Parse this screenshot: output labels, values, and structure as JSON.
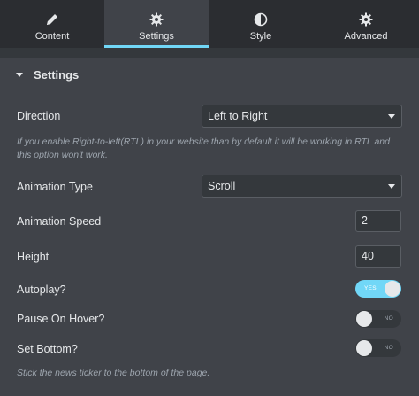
{
  "tabs": [
    {
      "label": "Content",
      "icon": "pencil-icon",
      "active": false
    },
    {
      "label": "Settings",
      "icon": "gear-icon",
      "active": true
    },
    {
      "label": "Style",
      "icon": "half-circle-icon",
      "active": false
    },
    {
      "label": "Advanced",
      "icon": "gear-icon",
      "active": false
    }
  ],
  "section": {
    "title": "Settings",
    "icon": "caret-down-icon"
  },
  "fields": {
    "direction": {
      "label": "Direction",
      "value": "Left to Right",
      "hint": "If you enable Right-to-left(RTL) in your website than by default it will be working in RTL and this option won't work."
    },
    "animation_type": {
      "label": "Animation Type",
      "value": "Scroll"
    },
    "animation_speed": {
      "label": "Animation Speed",
      "value": "2"
    },
    "height": {
      "label": "Height",
      "value": "40"
    },
    "autoplay": {
      "label": "Autoplay?",
      "state": "YES",
      "on": true
    },
    "pause_on_hover": {
      "label": "Pause On Hover?",
      "state": "NO",
      "on": false
    },
    "set_bottom": {
      "label": "Set Bottom?",
      "state": "NO",
      "on": false,
      "hint": "Stick the news ticker to the bottom of the page."
    }
  },
  "colors": {
    "accent": "#71d7f7",
    "panel": "#404349",
    "background": "#2b2d31",
    "text": "#e6e8ea",
    "hint": "#9da5ae"
  }
}
